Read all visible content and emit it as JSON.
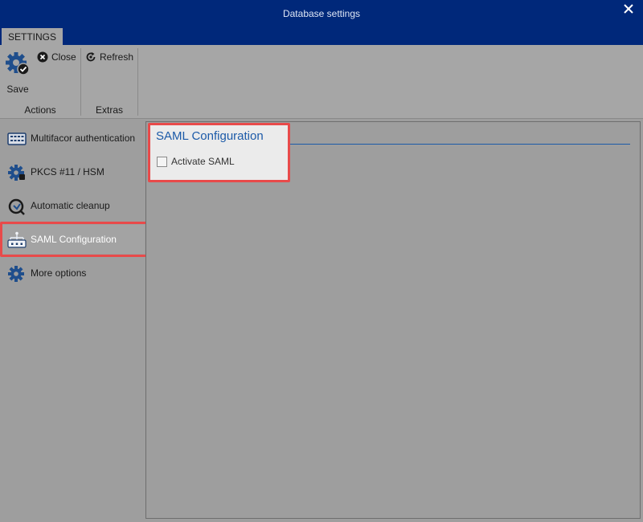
{
  "window": {
    "title": "Database settings"
  },
  "ribbon": {
    "tab_label": "SETTINGS",
    "actions": {
      "group_label": "Actions",
      "save_label": "Save",
      "close_label": "Close"
    },
    "extras": {
      "group_label": "Extras",
      "refresh_label": "Refresh"
    }
  },
  "sidebar": {
    "items": [
      {
        "label": "Multifacor authentication",
        "icon": "keypad-icon"
      },
      {
        "label": "PKCS #11 / HSM",
        "icon": "gear-icon"
      },
      {
        "label": "Automatic cleanup",
        "icon": "cleanup-icon"
      },
      {
        "label": "SAML Configuration",
        "icon": "network-icon",
        "active": true
      },
      {
        "label": "More options",
        "icon": "gear-icon"
      }
    ]
  },
  "main": {
    "section_title": "SAML Configuration",
    "activate_saml": {
      "label": "Activate SAML",
      "checked": false
    }
  },
  "colors": {
    "title_bar": "#00287a",
    "highlight": "#e84a4a",
    "section_header": "#1c5aa8"
  }
}
